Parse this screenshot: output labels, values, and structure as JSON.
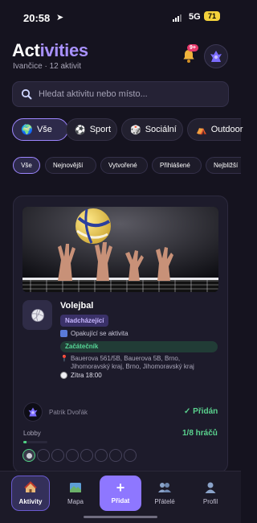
{
  "status_bar": {
    "time": "20:58",
    "network": "5G",
    "battery": "71"
  },
  "header": {
    "title_part1": "Act",
    "title_part2": "ivities",
    "subtitle": "Ivančice · 12 aktivit",
    "notification_count": "9+"
  },
  "search": {
    "placeholder": "Hledat aktivitu nebo místo..."
  },
  "categories": [
    {
      "icon": "globe",
      "label": "Vše",
      "active": true
    },
    {
      "icon": "soccer-ball",
      "label": "Sport",
      "active": false
    },
    {
      "icon": "dice",
      "label": "Sociální",
      "active": false
    },
    {
      "icon": "tent",
      "label": "Outdoor",
      "active": false
    }
  ],
  "filters": [
    {
      "label": "Vše",
      "active": true
    },
    {
      "label": "Nejnovější",
      "active": false
    },
    {
      "label": "Vytvořené",
      "active": false
    },
    {
      "label": "Přihlášené",
      "active": false
    },
    {
      "label": "Nejbližší",
      "active": false
    }
  ],
  "activity": {
    "title": "Volejbal",
    "status": "Nadcházející",
    "recurring": "Opakující se aktivita",
    "level": "Začátečník",
    "address": "Bauerova 561/5B, Bauerova 5B, Brno, Jihomoravský kraj, Brno, Jihomoravský kraj",
    "datetime": "Zítra 18:00",
    "organizer": "Patrik Dvořák",
    "added_label": "✓ Přidán",
    "lobby_label": "Lobby",
    "players": "1/8 hráčů",
    "lobby_fill_fraction": 0.125,
    "slots_total": 8,
    "slots_filled": 1
  },
  "nav": [
    {
      "label": "Aktivity",
      "icon": "house-icon",
      "active": true
    },
    {
      "label": "Mapa",
      "icon": "map-icon",
      "active": false
    },
    {
      "label": "Přidat",
      "icon": "plus-icon",
      "active": false
    },
    {
      "label": "Přátelé",
      "icon": "friends-icon",
      "active": false
    },
    {
      "label": "Profil",
      "icon": "profile-icon",
      "active": false
    }
  ],
  "colors": {
    "accent": "#8e77ff",
    "success": "#4fcf83",
    "badge": "#e7396b"
  }
}
